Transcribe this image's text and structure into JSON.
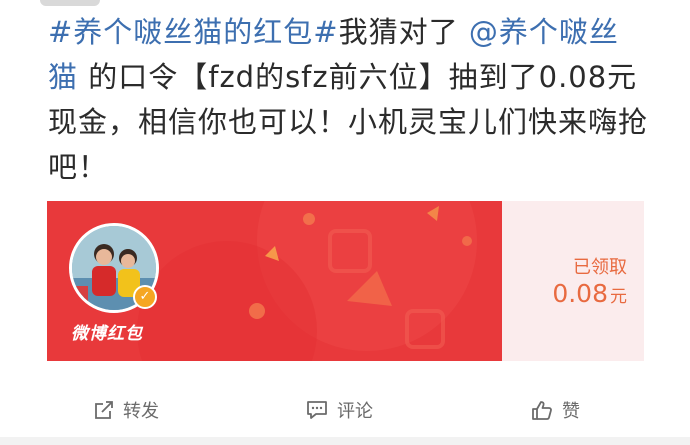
{
  "post": {
    "topic": "#养个啵丝猫的红包#",
    "text_1": "我猜对了",
    "mention": "@养个啵丝猫",
    "text_2": "的口令【fzd的sfz前六位】抽到了0.08元现金，相信你也可以！小机灵宝儿们快来嗨抢吧！"
  },
  "red_packet": {
    "brand_label": "微博红包",
    "status": "已领取",
    "amount": "0.08",
    "unit": "元",
    "verified_icon": "checkmark-icon"
  },
  "actions": {
    "repost": {
      "label": "转发",
      "icon": "share-icon"
    },
    "comment": {
      "label": "评论",
      "icon": "comment-icon"
    },
    "like": {
      "label": "赞",
      "icon": "thumbs-up-icon"
    }
  },
  "colors": {
    "link": "#3d6fb0",
    "card_red": "#e8393b",
    "amount_orange": "#e86a40",
    "text": "#2b2b2b",
    "action_gray": "#6b6b6b"
  }
}
